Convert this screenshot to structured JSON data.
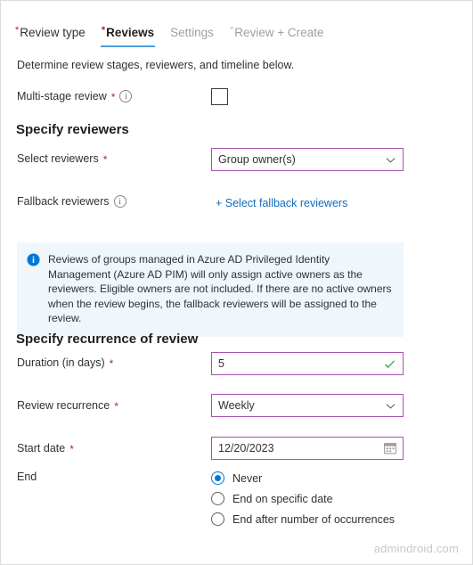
{
  "tabs": [
    {
      "label": "Review type",
      "required": true,
      "state": "complete"
    },
    {
      "label": "Reviews",
      "required": true,
      "state": "active"
    },
    {
      "label": "Settings",
      "required": false,
      "state": "disabled"
    },
    {
      "label": "Review + Create",
      "required": true,
      "state": "disabled"
    }
  ],
  "intro": "Determine review stages, reviewers, and timeline below.",
  "multistage": {
    "label": "Multi-stage review",
    "required_marker": "*",
    "info_icon": "info-icon",
    "checked": false
  },
  "reviewers_section": {
    "title": "Specify reviewers",
    "select_reviewers": {
      "label": "Select reviewers",
      "required_marker": "*",
      "value": "Group owner(s)",
      "icon": "chevron-down-icon"
    },
    "fallback_reviewers": {
      "label": "Fallback reviewers",
      "info_icon": "info-icon",
      "link": "+ Select fallback reviewers"
    }
  },
  "info_banner": {
    "icon": "info-filled-icon",
    "text": "Reviews of groups managed in Azure AD Privileged Identity Management (Azure AD PIM) will only assign active owners as the reviewers. Eligible owners are not included. If there are no active owners when the review begins, the fallback reviewers will be assigned to the review."
  },
  "recurrence_section": {
    "title": "Specify recurrence of review",
    "duration": {
      "label": "Duration (in days)",
      "required_marker": "*",
      "value": "5",
      "icon": "checkmark-icon",
      "valid": true
    },
    "review_recurrence": {
      "label": "Review recurrence",
      "required_marker": "*",
      "value": "Weekly",
      "icon": "chevron-down-icon"
    },
    "start_date": {
      "label": "Start date",
      "required_marker": "*",
      "value": "12/20/2023",
      "icon": "calendar-icon"
    },
    "end": {
      "label": "End",
      "options": [
        {
          "label": "Never",
          "selected": true
        },
        {
          "label": "End on specific date",
          "selected": false
        },
        {
          "label": "End after number of occurrences",
          "selected": false
        }
      ]
    }
  },
  "watermark": "admindroid.com",
  "colors": {
    "accent_tab_underline": "#4a9fe0",
    "field_border": "#a653b0",
    "link": "#0f6cbd",
    "required_asterisk": "#a4262c",
    "banner_bg": "#eff6fc",
    "banner_icon": "#0078d4",
    "radio_selected": "#0078d4",
    "valid_check": "#107c10",
    "watermark": "#c8c8c8"
  }
}
